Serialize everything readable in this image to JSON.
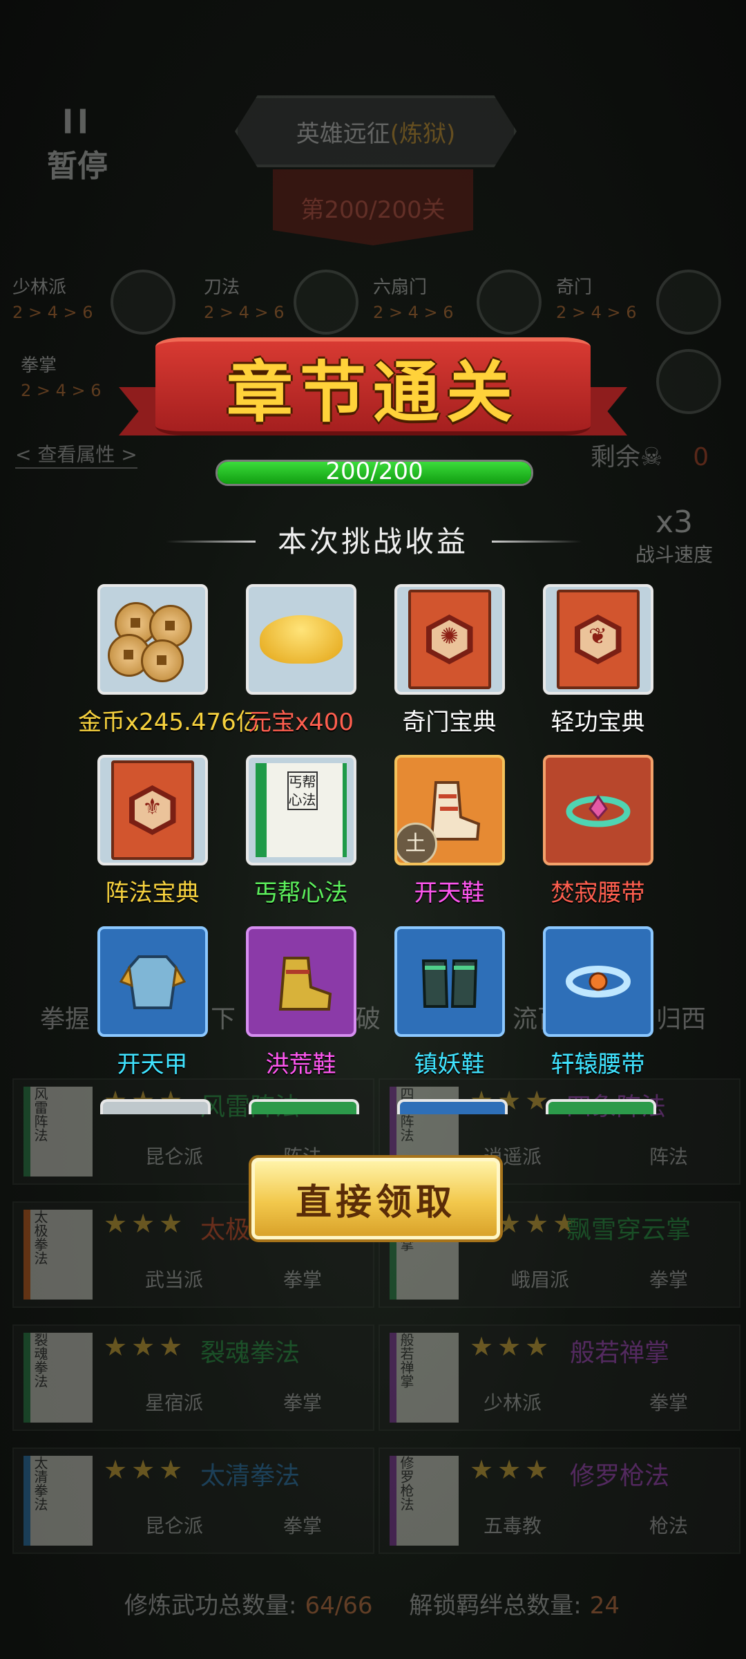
{
  "background": {
    "mode_title": "英雄远征",
    "mode_sub": "(炼狱)",
    "stage": "第200/200关",
    "pause_label": "暂停",
    "pause_icon": "ll",
    "sects_row1": [
      {
        "name": "少林派",
        "ratio": "2 > 4 > 6"
      },
      {
        "name": "刀法",
        "ratio": "2 > 4 > 6"
      },
      {
        "name": "六扇门",
        "ratio": "2 > 4 > 6"
      },
      {
        "name": "奇门",
        "ratio": "2 > 4 > 6"
      }
    ],
    "sects_row2": [
      {
        "name": "拳掌",
        "ratio": "2 > 4 > 6"
      }
    ],
    "view_attributes": "< 查看属性 >",
    "remaining_label": "剩余",
    "remaining_count": "0",
    "speed_value": "x3",
    "speed_label": "战斗速度",
    "skill_row": [
      "拳握",
      "下",
      "破",
      "流百",
      "归西"
    ],
    "skill_cards": [
      {
        "name": "风雷阵法",
        "stars": "★★★",
        "sect": "昆仑派",
        "type": "阵法",
        "book": "风雷阵法"
      },
      {
        "name": "四象阵法",
        "stars": "★★★",
        "sect": "逍遥派",
        "type": "阵法",
        "book": "四象阵法"
      },
      {
        "name": "太极",
        "stars": "★★★",
        "sect": "武当派",
        "type": "拳掌",
        "book": "太极拳法"
      },
      {
        "name": "飘雪穿云掌",
        "stars": "★★★",
        "sect": "峨眉派",
        "type": "拳掌",
        "book": "穿云掌"
      },
      {
        "name": "裂魂拳法",
        "stars": "★★★",
        "sect": "星宿派",
        "type": "拳掌",
        "book": "裂魂拳法"
      },
      {
        "name": "般若禅掌",
        "stars": "★★★",
        "sect": "少林派",
        "type": "拳掌",
        "book": "般若禅掌"
      },
      {
        "name": "太清拳法",
        "stars": "★★★",
        "sect": "昆仑派",
        "type": "拳掌",
        "book": "太清拳法"
      },
      {
        "name": "修罗枪法",
        "stars": "★★★",
        "sect": "五毒教",
        "type": "枪法",
        "book": "修罗枪法"
      }
    ],
    "footer_cultivate_label": "修炼武功总数量:",
    "footer_cultivate_value": "64/66",
    "footer_bond_label": "解锁羁绊总数量:",
    "footer_bond_value": "24"
  },
  "overlay": {
    "banner_title": "章节通关",
    "progress_text": "200/200",
    "progress_fraction": 1.0,
    "rewards_title": "本次挑战收益",
    "rewards": [
      {
        "label": "金币x245.476亿",
        "icon": "coins-icon",
        "color": "#f7d23e"
      },
      {
        "label": "元宝x400",
        "icon": "gold-ingot-icon",
        "color": "#ff5f4f"
      },
      {
        "label": "奇门宝典",
        "icon": "qimen-manual-icon",
        "color": "#ffffff"
      },
      {
        "label": "轻功宝典",
        "icon": "qinggong-manual-icon",
        "color": "#ffffff"
      },
      {
        "label": "阵法宝典",
        "icon": "formation-manual-icon",
        "color": "#f7d23e"
      },
      {
        "label": "丐帮心法",
        "icon": "beggar-sect-manual-icon",
        "color": "#5cf05c",
        "book_text": "丐帮心法"
      },
      {
        "label": "开天鞋",
        "icon": "kaitian-boots-icon",
        "color": "#ff56f0",
        "badge": "土"
      },
      {
        "label": "焚寂腰带",
        "icon": "fenji-belt-icon",
        "color": "#ff5f4f"
      },
      {
        "label": "开天甲",
        "icon": "kaitian-armor-icon",
        "color": "#3fe3ff"
      },
      {
        "label": "洪荒鞋",
        "icon": "honghuang-boots-icon",
        "color": "#ff56f0"
      },
      {
        "label": "镇妖鞋",
        "icon": "zhenyao-boots-icon",
        "color": "#3fe3ff"
      },
      {
        "label": "轩辕腰带",
        "icon": "xuanyuan-belt-icon",
        "color": "#3fe3ff"
      }
    ],
    "claim_button": "直接领取"
  }
}
